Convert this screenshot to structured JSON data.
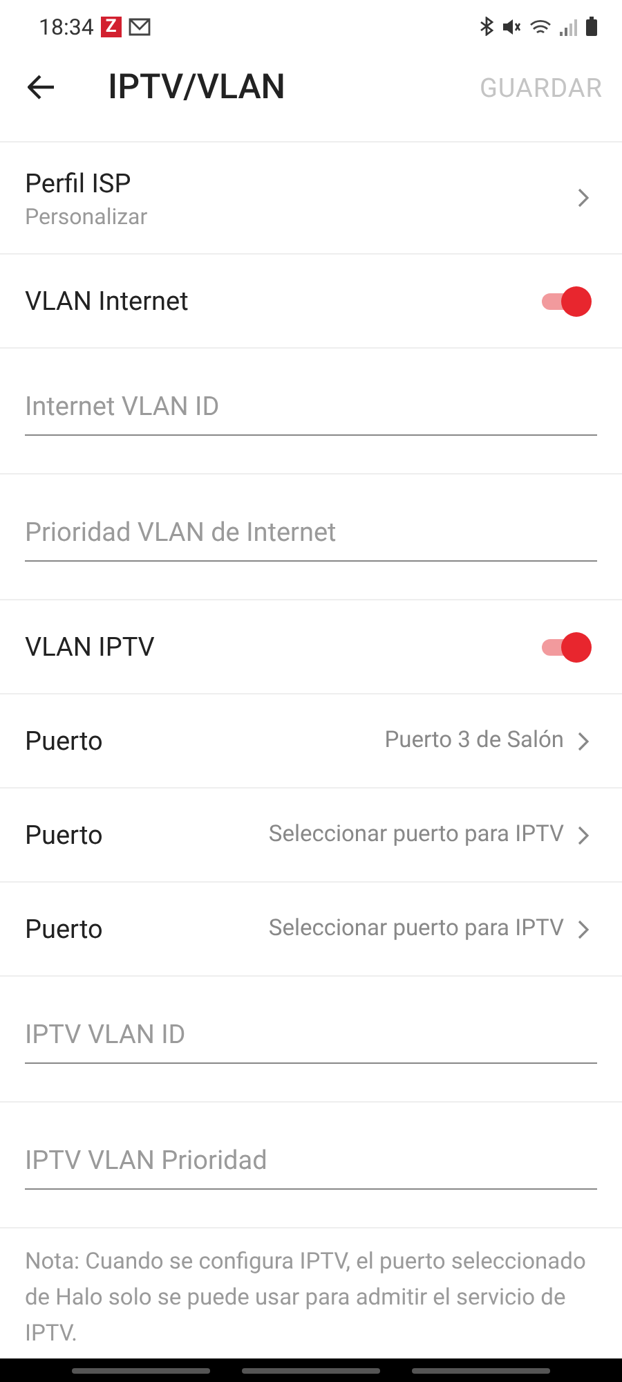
{
  "status_bar": {
    "time": "18:34",
    "app_badge": "Z"
  },
  "header": {
    "title": "IPTV/VLAN",
    "action": {
      "label": "GUARDAR",
      "disabled": true
    }
  },
  "rows": [
    {
      "kind": "nav",
      "label": "Perfil ISP",
      "sublabel": "Personalizar"
    },
    {
      "kind": "toggle",
      "label": "VLAN Internet",
      "on": true
    },
    {
      "kind": "field",
      "placeholder": "Internet VLAN ID"
    },
    {
      "kind": "field",
      "placeholder": "Prioridad VLAN de Internet"
    },
    {
      "kind": "toggle",
      "label": "VLAN IPTV",
      "on": true
    },
    {
      "kind": "nav",
      "label": "Puerto",
      "value": "Puerto 3 de Salón"
    },
    {
      "kind": "nav",
      "label": "Puerto",
      "value": "Seleccionar puerto para IPTV"
    },
    {
      "kind": "nav",
      "label": "Puerto",
      "value": "Seleccionar puerto para IPTV"
    },
    {
      "kind": "field",
      "placeholder": "IPTV VLAN ID"
    },
    {
      "kind": "field",
      "placeholder": "IPTV VLAN Prioridad"
    }
  ],
  "note": "Nota: Cuando se configura IPTV, el puerto seleccionado de Halo solo se puede usar para admitir el servicio de IPTV."
}
